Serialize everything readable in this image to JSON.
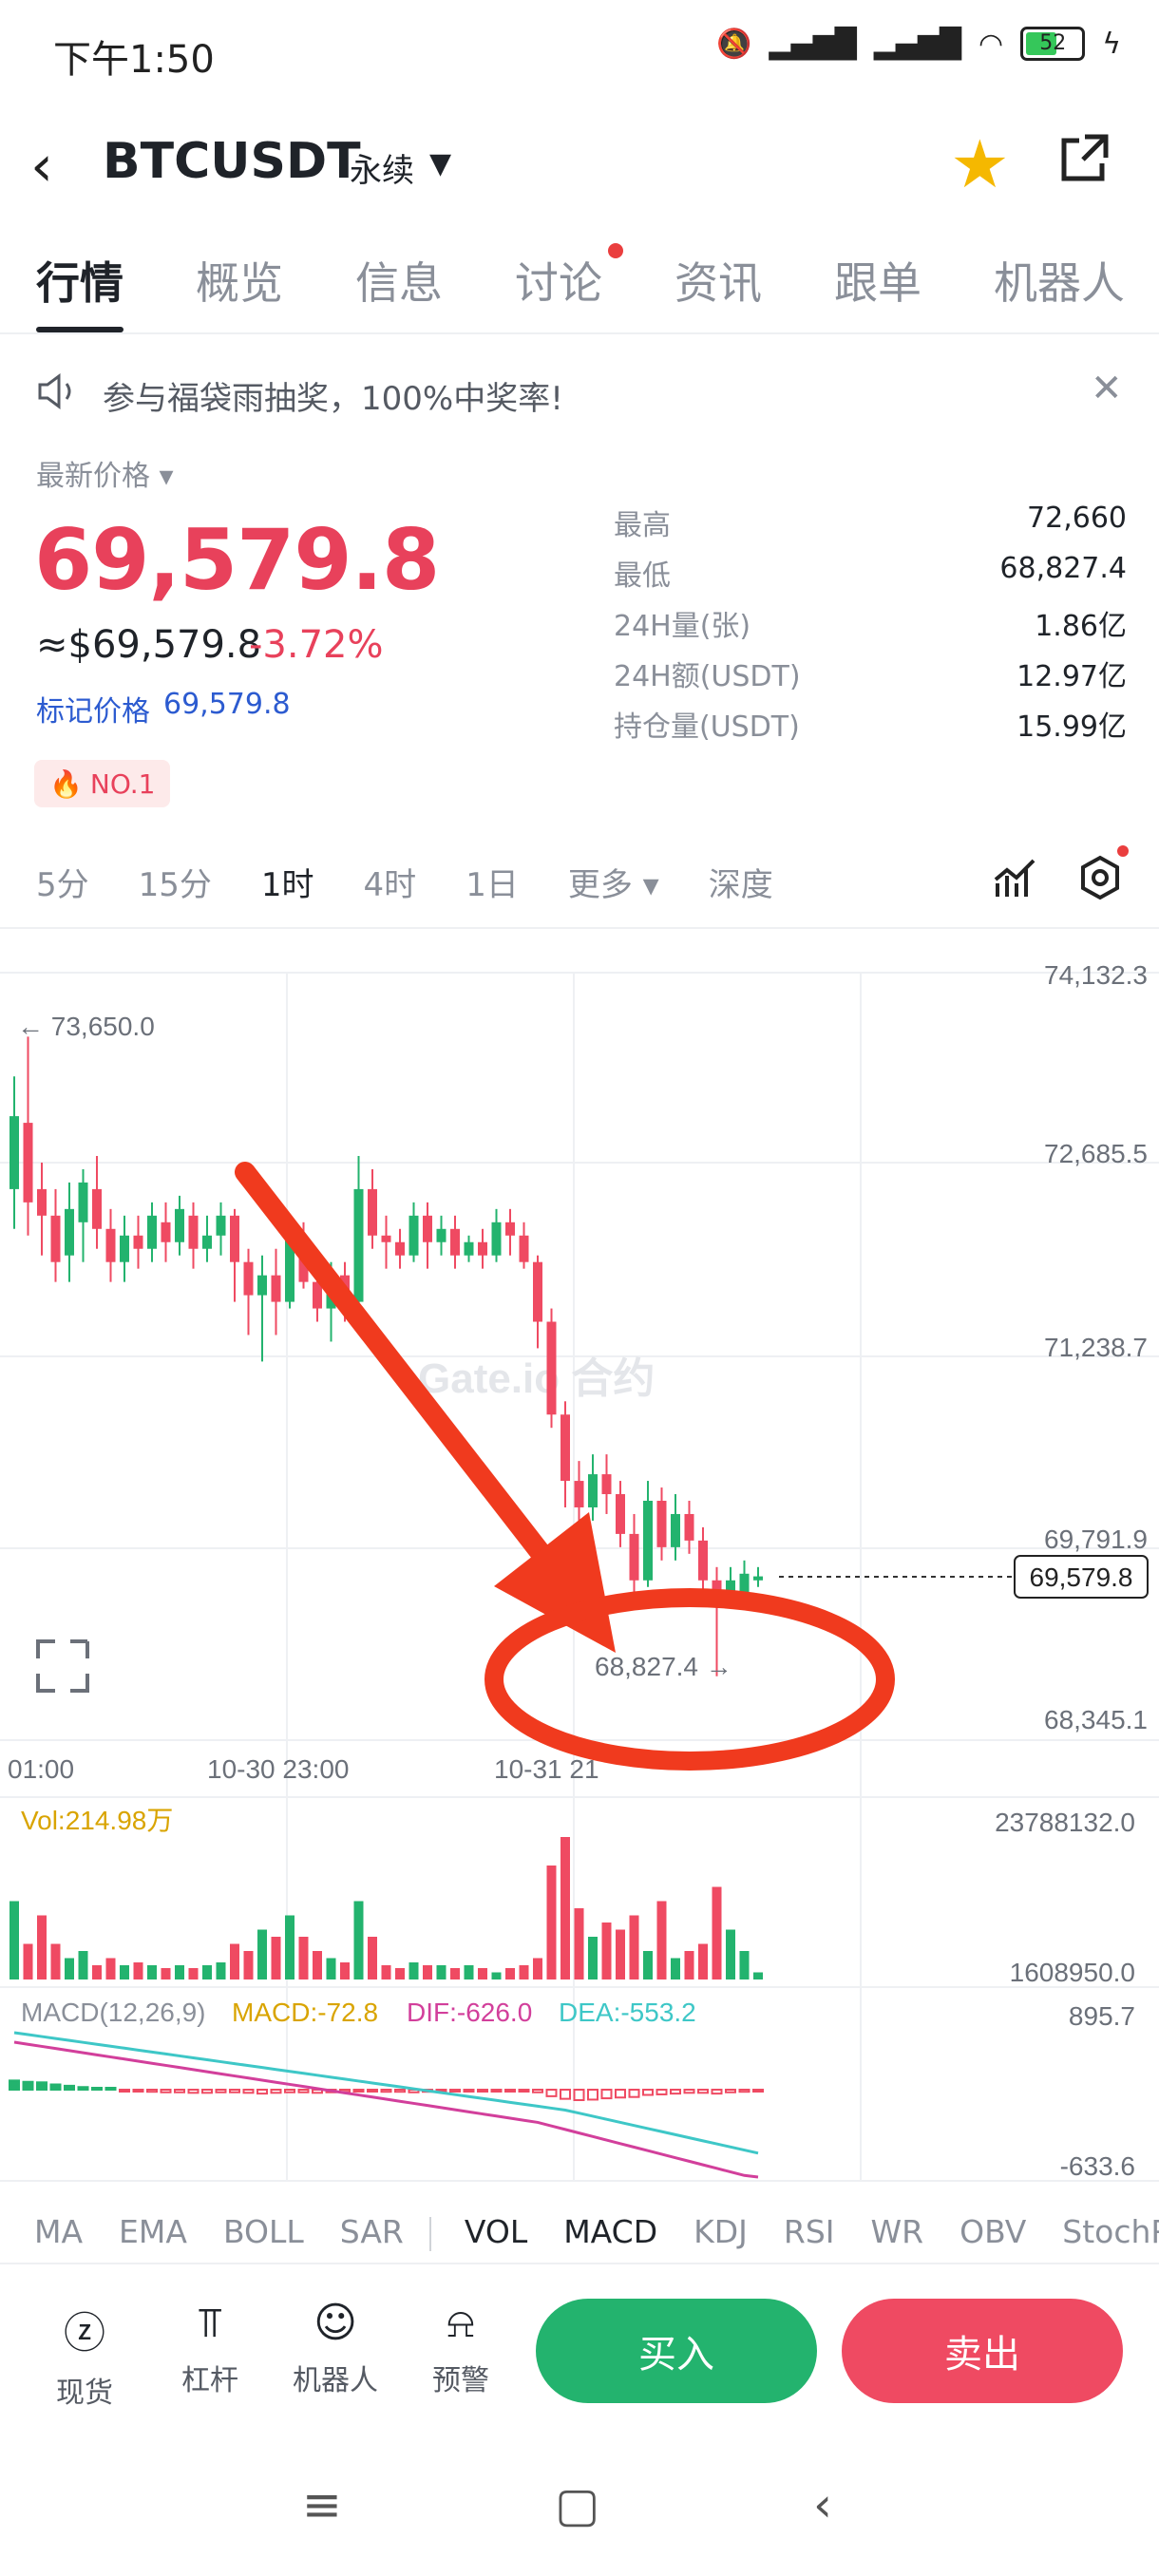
{
  "status": {
    "time": "下午1:50",
    "battery": "52"
  },
  "header": {
    "pair": "BTCUSDT",
    "contract": "永续"
  },
  "tabs": [
    "行情",
    "概览",
    "信息",
    "讨论",
    "资讯",
    "跟单",
    "机器人"
  ],
  "announcement": "参与福袋雨抽奖，100%中奖率!",
  "price": {
    "latest_label": "最新价格",
    "last": "69,579.8",
    "usd": "≈$69,579.8",
    "change_pct": "-3.72%",
    "mark_label": "标记价格",
    "mark": "69,579.8",
    "rank": "NO.1"
  },
  "stats": [
    {
      "k": "最高",
      "v": "72,660"
    },
    {
      "k": "最低",
      "v": "68,827.4"
    },
    {
      "k": "24H量(张)",
      "v": "1.86亿"
    },
    {
      "k": "24H额(USDT)",
      "v": "12.97亿"
    },
    {
      "k": "持仓量(USDT)",
      "v": "15.99亿"
    }
  ],
  "intervals": [
    "5分",
    "15分",
    "1时",
    "4时",
    "1日",
    "更多",
    "深度"
  ],
  "chart": {
    "price_labels": [
      "74,132.3",
      "72,685.5",
      "71,238.7",
      "69,791.9",
      "68,345.1"
    ],
    "high_marker": "← 73,650.0",
    "low_marker": "68,827.4 →",
    "last_tag": "69,579.8",
    "watermark": "Gate.io 合约",
    "time_labels": [
      "01:00",
      "10-30 23:00",
      "10-31 21"
    ],
    "vol_label": "Vol:214.98万",
    "vol_max": "23788132.0",
    "vol_min": "1608950.0",
    "macd_params": "MACD(12,26,9)",
    "macd_val": "MACD:-72.8",
    "dif_val": "DIF:-626.0",
    "dea_val": "DEA:-553.2",
    "macd_max": "895.7",
    "macd_min": "-633.6"
  },
  "indicators": [
    "MA",
    "EMA",
    "BOLL",
    "SAR",
    "VOL",
    "MACD",
    "KDJ",
    "RSI",
    "WR",
    "OBV",
    "StochRSI"
  ],
  "actions": [
    {
      "icon": "spot-icon",
      "label": "现货"
    },
    {
      "icon": "leverage-icon",
      "label": "杠杆"
    },
    {
      "icon": "robot-icon",
      "label": "机器人"
    },
    {
      "icon": "alert-icon",
      "label": "预警"
    }
  ],
  "buy": "买入",
  "sell": "卖出",
  "colors": {
    "up": "#23b36e",
    "down": "#ef4a62",
    "annotation": "#f03a1e"
  },
  "candles": [
    [
      72500,
      73050,
      73350,
      72200
    ],
    [
      73000,
      72400,
      73650,
      72150
    ],
    [
      72500,
      72300,
      72700,
      72000
    ],
    [
      72300,
      71950,
      72500,
      71800
    ],
    [
      72000,
      72350,
      72550,
      71800
    ],
    [
      72250,
      72550,
      72650,
      71950
    ],
    [
      72500,
      72200,
      72750,
      72050
    ],
    [
      72200,
      71950,
      72350,
      71800
    ],
    [
      71950,
      72150,
      72300,
      71800
    ],
    [
      72150,
      72050,
      72300,
      71900
    ],
    [
      72050,
      72300,
      72400,
      71950
    ],
    [
      72250,
      72100,
      72400,
      71950
    ],
    [
      72100,
      72350,
      72450,
      72000
    ],
    [
      72300,
      72050,
      72400,
      71900
    ],
    [
      72050,
      72150,
      72300,
      71950
    ],
    [
      72150,
      72300,
      72400,
      72000
    ],
    [
      72300,
      71950,
      72350,
      71650
    ],
    [
      71950,
      71700,
      72050,
      71400
    ],
    [
      71700,
      71850,
      72000,
      71200
    ],
    [
      71850,
      71650,
      72050,
      71400
    ],
    [
      71650,
      72150,
      72250,
      71600
    ],
    [
      72100,
      71800,
      72250,
      71750
    ],
    [
      71800,
      71600,
      71950,
      71500
    ],
    [
      71600,
      71850,
      71950,
      71350
    ],
    [
      71850,
      71650,
      71950,
      71500
    ],
    [
      71650,
      72500,
      72750,
      71600
    ],
    [
      72500,
      72150,
      72650,
      72050
    ],
    [
      72150,
      72100,
      72300,
      71900
    ],
    [
      72100,
      72000,
      72200,
      71900
    ],
    [
      72000,
      72300,
      72400,
      71950
    ],
    [
      72300,
      72100,
      72400,
      71900
    ],
    [
      72100,
      72200,
      72300,
      72000
    ],
    [
      72200,
      72000,
      72300,
      71900
    ],
    [
      72000,
      72100,
      72150,
      71950
    ],
    [
      72100,
      72000,
      72200,
      71900
    ],
    [
      72000,
      72250,
      72350,
      71950
    ],
    [
      72250,
      72150,
      72350,
      72000
    ],
    [
      72150,
      71950,
      72250,
      71900
    ],
    [
      71950,
      71500,
      72000,
      71300
    ],
    [
      71500,
      70800,
      71600,
      70700
    ],
    [
      70800,
      70300,
      70900,
      70100
    ],
    [
      70300,
      70100,
      70450,
      69900
    ],
    [
      70100,
      70350,
      70500,
      70000
    ],
    [
      70350,
      70200,
      70500,
      70050
    ],
    [
      70200,
      69900,
      70300,
      69800
    ],
    [
      69900,
      69550,
      70050,
      69450
    ],
    [
      69550,
      70150,
      70300,
      69500
    ],
    [
      70150,
      69800,
      70250,
      69700
    ],
    [
      69800,
      70050,
      70200,
      69700
    ],
    [
      70050,
      69850,
      70150,
      69750
    ],
    [
      69850,
      69550,
      69950,
      69450
    ],
    [
      69550,
      69350,
      69650,
      68827
    ],
    [
      69450,
      69550,
      69650,
      69400
    ],
    [
      69450,
      69600,
      69700,
      69400
    ],
    [
      69550,
      69580,
      69650,
      69500
    ]
  ],
  "volumes": [
    0.55,
    0.25,
    0.45,
    0.25,
    0.15,
    0.2,
    0.1,
    0.15,
    0.1,
    0.12,
    0.1,
    0.08,
    0.1,
    0.08,
    0.1,
    0.12,
    0.25,
    0.2,
    0.35,
    0.3,
    0.45,
    0.3,
    0.2,
    0.15,
    0.12,
    0.55,
    0.3,
    0.1,
    0.08,
    0.12,
    0.1,
    0.1,
    0.08,
    0.1,
    0.08,
    0.05,
    0.08,
    0.1,
    0.15,
    0.8,
    1.0,
    0.5,
    0.3,
    0.4,
    0.35,
    0.45,
    0.2,
    0.55,
    0.15,
    0.2,
    0.25,
    0.65,
    0.35,
    0.2,
    0.05
  ],
  "macd_hist": [
    0.35,
    0.3,
    0.28,
    0.2,
    0.15,
    0.1,
    0.05,
    0.02,
    -0.02,
    -0.05,
    -0.08,
    -0.1,
    -0.1,
    -0.12,
    -0.12,
    -0.1,
    -0.1,
    -0.12,
    -0.15,
    -0.12,
    -0.1,
    -0.1,
    -0.12,
    -0.1,
    -0.08,
    -0.05,
    -0.05,
    -0.08,
    -0.08,
    -0.1,
    -0.08,
    -0.06,
    -0.06,
    -0.05,
    -0.06,
    -0.06,
    -0.05,
    -0.05,
    -0.1,
    -0.25,
    -0.35,
    -0.4,
    -0.38,
    -0.33,
    -0.3,
    -0.28,
    -0.2,
    -0.18,
    -0.15,
    -0.12,
    -0.12,
    -0.15,
    -0.1,
    -0.08,
    -0.07
  ]
}
